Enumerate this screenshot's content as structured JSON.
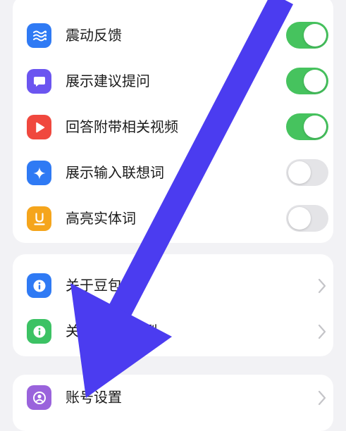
{
  "settings_group": {
    "items": [
      {
        "label": "震动反馈",
        "icon": "waves-icon",
        "icon_color": "#2f7af4",
        "toggle_on": true
      },
      {
        "label": "展示建议提问",
        "icon": "chat-bubble-icon",
        "icon_color": "#6b55f0",
        "toggle_on": true
      },
      {
        "label": "回答附带相关视频",
        "icon": "play-icon",
        "icon_color": "#f0483e",
        "toggle_on": true
      },
      {
        "label": "展示输入联想词",
        "icon": "sparkle-icon",
        "icon_color": "#2f7af4",
        "toggle_on": false
      },
      {
        "label": "高亮实体词",
        "icon": "underline-u-icon",
        "icon_color": "#f5a51c",
        "toggle_on": false
      }
    ]
  },
  "about_group": {
    "items": [
      {
        "label": "关于豆包",
        "icon": "info-icon",
        "icon_color": "#2f7af4"
      },
      {
        "label": "关于        模型",
        "icon": "info-icon",
        "icon_color": "#3cc264"
      }
    ]
  },
  "account_group": {
    "items": [
      {
        "label": "账号设置",
        "icon": "user-icon",
        "icon_color": "#9a63dc"
      }
    ]
  },
  "colors": {
    "toggle_on": "#46c35e",
    "toggle_off": "#e4e4e7",
    "annotation_arrow": "#4b3cf0"
  }
}
